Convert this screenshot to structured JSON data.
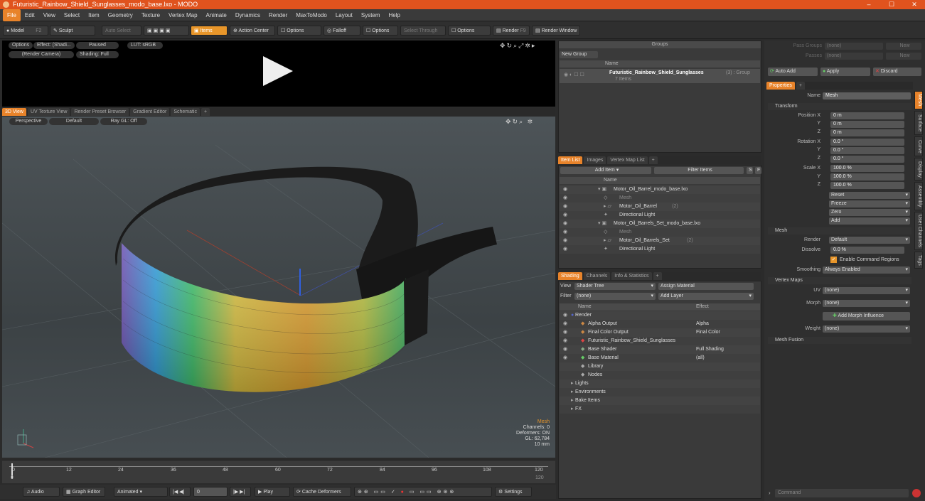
{
  "app": {
    "title": "Futuristic_Rainbow_Shield_Sunglasses_modo_base.lxo - MODO",
    "minimize": "–",
    "maximize": "☐",
    "close": "✕"
  },
  "menu": [
    "File",
    "Edit",
    "View",
    "Select",
    "Item",
    "Geometry",
    "Texture",
    "Vertex Map",
    "Animate",
    "Dynamics",
    "Render",
    "MaxToModo",
    "Layout",
    "System",
    "Help"
  ],
  "toolbar": {
    "model": "Model",
    "f2": "F2",
    "sculpt": "Sculpt",
    "auto_select": "Auto Select",
    "items": "Items",
    "action_center": "Action Center",
    "options1": "Options",
    "falloff": "Falloff",
    "options2": "Options",
    "select_through": "Select Through",
    "options3": "Options",
    "render": "Render",
    "f9": "F9",
    "render_window": "Render Window"
  },
  "preview": {
    "options": "Options",
    "effect": "Effect: (Shadi...",
    "paused": "Paused",
    "lut": "LUT: sRGB",
    "camera": "(Render Camera)",
    "shading": "Shading: Full"
  },
  "viewport_tabs": [
    "3D View",
    "UV Texture View",
    "Render Preset Browser",
    "Gradient Editor",
    "Schematic",
    "+"
  ],
  "viewport": {
    "perspective": "Perspective",
    "default": "Default",
    "raygl": "Ray GL: Off",
    "info_title": "Mesh",
    "channels": "Channels: 0",
    "deformers": "Deformers: ON",
    "gl": "GL: 62,784",
    "unit": "10 mm"
  },
  "timeline": {
    "ticks": [
      "0",
      "12",
      "24",
      "36",
      "48",
      "60",
      "72",
      "84",
      "96",
      "108",
      "120"
    ],
    "end": "120"
  },
  "bottombar": {
    "audio": "Audio",
    "graph_editor": "Graph Editor",
    "animated": "Animated",
    "frame": "0",
    "play": "Play",
    "cache": "Cache Deformers",
    "settings": "Settings"
  },
  "groups": {
    "title": "Groups",
    "new_group": "New Group",
    "col_name": "Name",
    "item_name": "Futuristic_Rainbow_Shield_Sunglasses",
    "item_suffix": "(3) : Group",
    "item_count": "7 Items"
  },
  "itemlist": {
    "tabs": [
      "Item List",
      "Images",
      "Vertex Map List",
      "+"
    ],
    "add_item": "Add Item",
    "filter": "Filter Items",
    "s": "S",
    "f": "F",
    "col_name": "Name",
    "rows": [
      {
        "label": "Motor_Oil_Barrel_modo_base.lxo",
        "indent": 0
      },
      {
        "label": "Mesh",
        "indent": 1,
        "dim": true
      },
      {
        "label": "Motor_Oil_Barrel",
        "suffix": "(2)",
        "indent": 1
      },
      {
        "label": "Directional Light",
        "indent": 1
      },
      {
        "label": "Motor_Oil_Barrels_Set_modo_base.lxo",
        "indent": 0
      },
      {
        "label": "Mesh",
        "indent": 1,
        "dim": true
      },
      {
        "label": "Motor_Oil_Barrels_Set",
        "suffix": "(2)",
        "indent": 1
      },
      {
        "label": "Directional Light",
        "indent": 1
      }
    ]
  },
  "shading": {
    "tabs": [
      "Shading",
      "Channels",
      "Info & Statistics",
      "+"
    ],
    "view_label": "View",
    "view_value": "Shader Tree",
    "assign": "Assign Material",
    "filter_label": "Filter",
    "filter_value": "(none)",
    "add_layer": "Add Layer",
    "col_name": "Name",
    "col_effect": "Effect",
    "rows": [
      {
        "label": "Render",
        "effect": "",
        "indent": 0
      },
      {
        "label": "Alpha Output",
        "effect": "Alpha",
        "indent": 1
      },
      {
        "label": "Final Color Output",
        "effect": "Final Color",
        "indent": 1
      },
      {
        "label": "Futuristic_Rainbow_Shield_Sunglasses",
        "effect": "",
        "indent": 1
      },
      {
        "label": "Base Shader",
        "effect": "Full Shading",
        "indent": 1
      },
      {
        "label": "Base Material",
        "effect": "(all)",
        "indent": 1
      },
      {
        "label": "Library",
        "effect": "",
        "indent": 1
      },
      {
        "label": "Nodes",
        "effect": "",
        "indent": 1
      },
      {
        "label": "Lights",
        "effect": "",
        "indent": 0
      },
      {
        "label": "Environments",
        "effect": "",
        "indent": 0
      },
      {
        "label": "Bake Items",
        "effect": "",
        "indent": 0
      },
      {
        "label": "FX",
        "effect": "",
        "indent": 0
      }
    ]
  },
  "props": {
    "pass_groups": "Pass Groups",
    "passes": "Passes",
    "none": "(none)",
    "new": "New",
    "auto_add": "Auto Add",
    "apply": "Apply",
    "discard": "Discard",
    "tab": "Properties",
    "name_label": "Name",
    "name_value": "Mesh",
    "transform": "Transform",
    "position_x": "Position X",
    "y": "Y",
    "z": "Z",
    "pos": [
      "0 m",
      "0 m",
      "0 m"
    ],
    "rotation_x": "Rotation X",
    "rot": [
      "0.0 °",
      "0.0 °",
      "0.0 °"
    ],
    "scale_x": "Scale X",
    "scale": [
      "100.0 %",
      "100.0 %",
      "100.0 %"
    ],
    "reset": "Reset",
    "freeze": "Freeze",
    "zero": "Zero",
    "add": "Add",
    "mesh": "Mesh",
    "render_label": "Render",
    "render_value": "Default",
    "dissolve_label": "Dissolve",
    "dissolve_value": "0.0 %",
    "enable_cmd": "Enable Command Regions",
    "smoothing_label": "Smoothing",
    "smoothing_value": "Always Enabled",
    "vertex_maps": "Vertex Maps",
    "uv_label": "UV",
    "morph_label": "Morph",
    "add_morph": "Add Morph Influence",
    "weight_label": "Weight",
    "mesh_fusion": "Mesh Fusion",
    "command": "Command",
    "side_tabs": [
      "Mesh",
      "Surface",
      "Curve",
      "Display",
      "Assembly",
      "User Channels",
      "Tags"
    ]
  },
  "colors": {
    "accent": "#e8832a",
    "titlebar": "#e0531e"
  }
}
